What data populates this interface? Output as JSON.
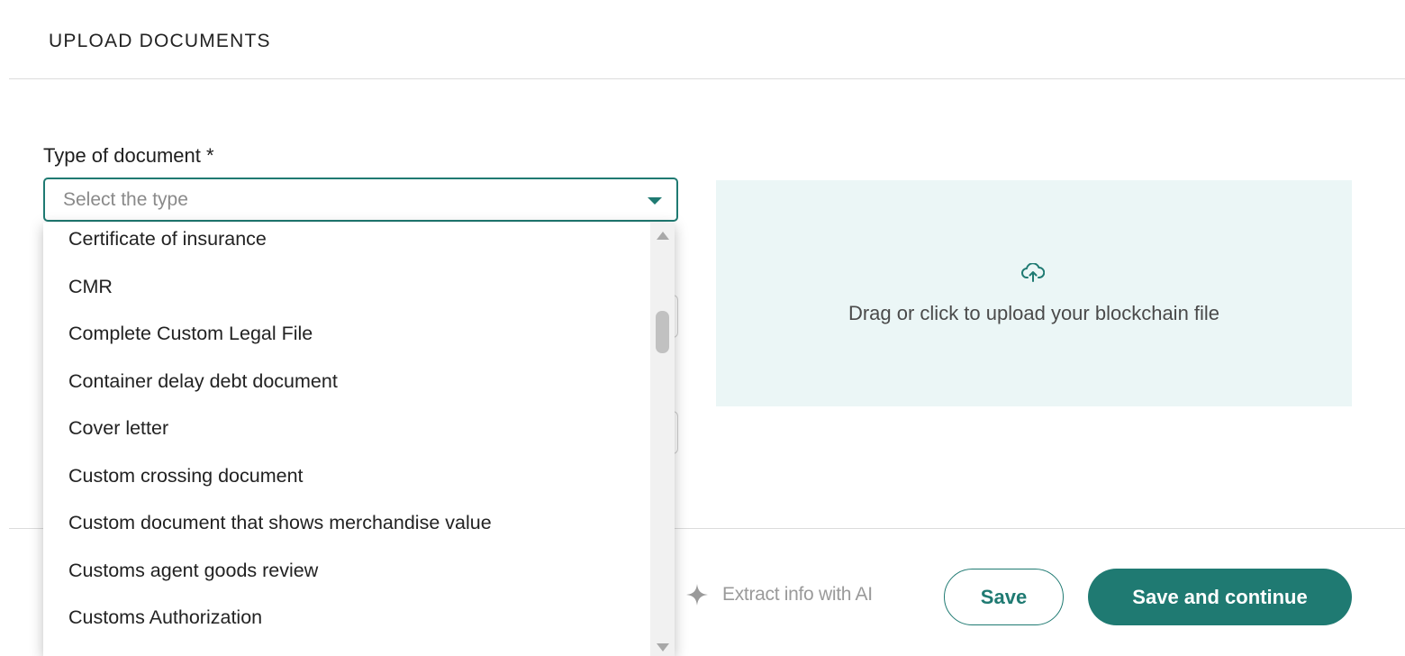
{
  "header": {
    "title": "UPLOAD DOCUMENTS"
  },
  "form": {
    "type_label": "Type of document *",
    "type_placeholder": "Select the type",
    "options": [
      "Certificate of insurance",
      "CMR",
      "Complete Custom Legal File",
      "Container delay debt document",
      "Cover letter",
      "Custom crossing document",
      "Custom document that shows merchandise value",
      "Customs agent goods review",
      "Customs Authorization"
    ]
  },
  "upload": {
    "text": "Drag or click to upload your blockchain file",
    "icon": "cloud-upload-icon"
  },
  "footer": {
    "ai_label": "Extract info with AI",
    "save_label": "Save",
    "continue_label": "Save and continue"
  },
  "colors": {
    "accent": "#1f7a72",
    "upload_bg": "#ebf6f6",
    "disabled": "#9a9a9a"
  }
}
